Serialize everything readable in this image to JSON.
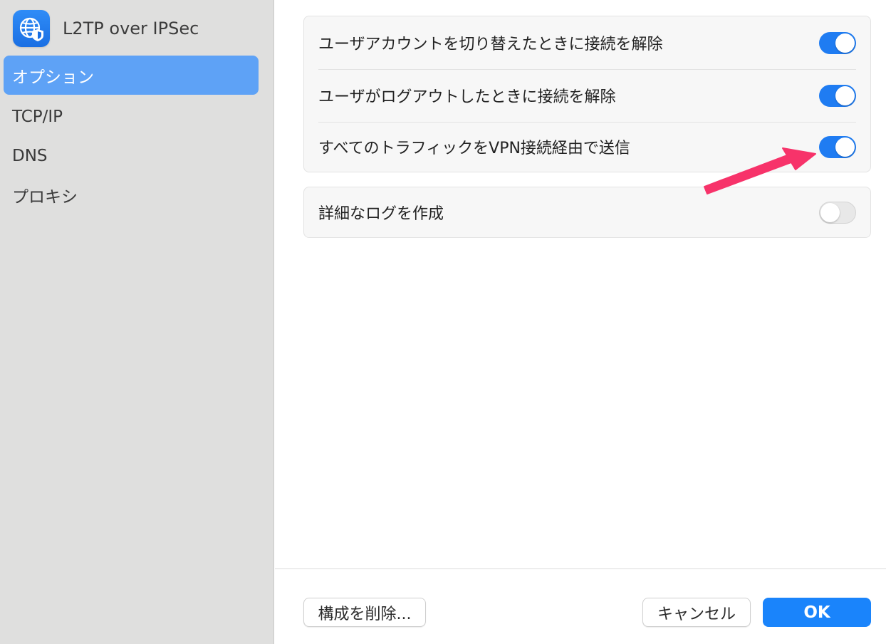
{
  "sidebar": {
    "app_icon": "globe-shield-icon",
    "title": "L2TP over IPSec",
    "items": [
      {
        "label": "オプション",
        "selected": true
      },
      {
        "label": "TCP/IP",
        "selected": false
      },
      {
        "label": "DNS",
        "selected": false
      },
      {
        "label": "プロキシ",
        "selected": false
      }
    ]
  },
  "options": {
    "group1": [
      {
        "label": "ユーザアカウントを切り替えたときに接続を解除",
        "enabled": true
      },
      {
        "label": "ユーザがログアウトしたときに接続を解除",
        "enabled": true
      },
      {
        "label": "すべてのトラフィックをVPN接続経由で送信",
        "enabled": true
      }
    ],
    "group2": [
      {
        "label": "詳細なログを作成",
        "enabled": false
      }
    ]
  },
  "annotation": {
    "icon": "arrow-annotation-icon",
    "color": "#f7336a"
  },
  "footer": {
    "delete_label": "構成を削除...",
    "cancel_label": "キャンセル",
    "ok_label": "OK"
  },
  "colors": {
    "accent": "#1f7cf2",
    "sidebar_selected": "#5ea2f6",
    "primary_button": "#1a84fb"
  }
}
